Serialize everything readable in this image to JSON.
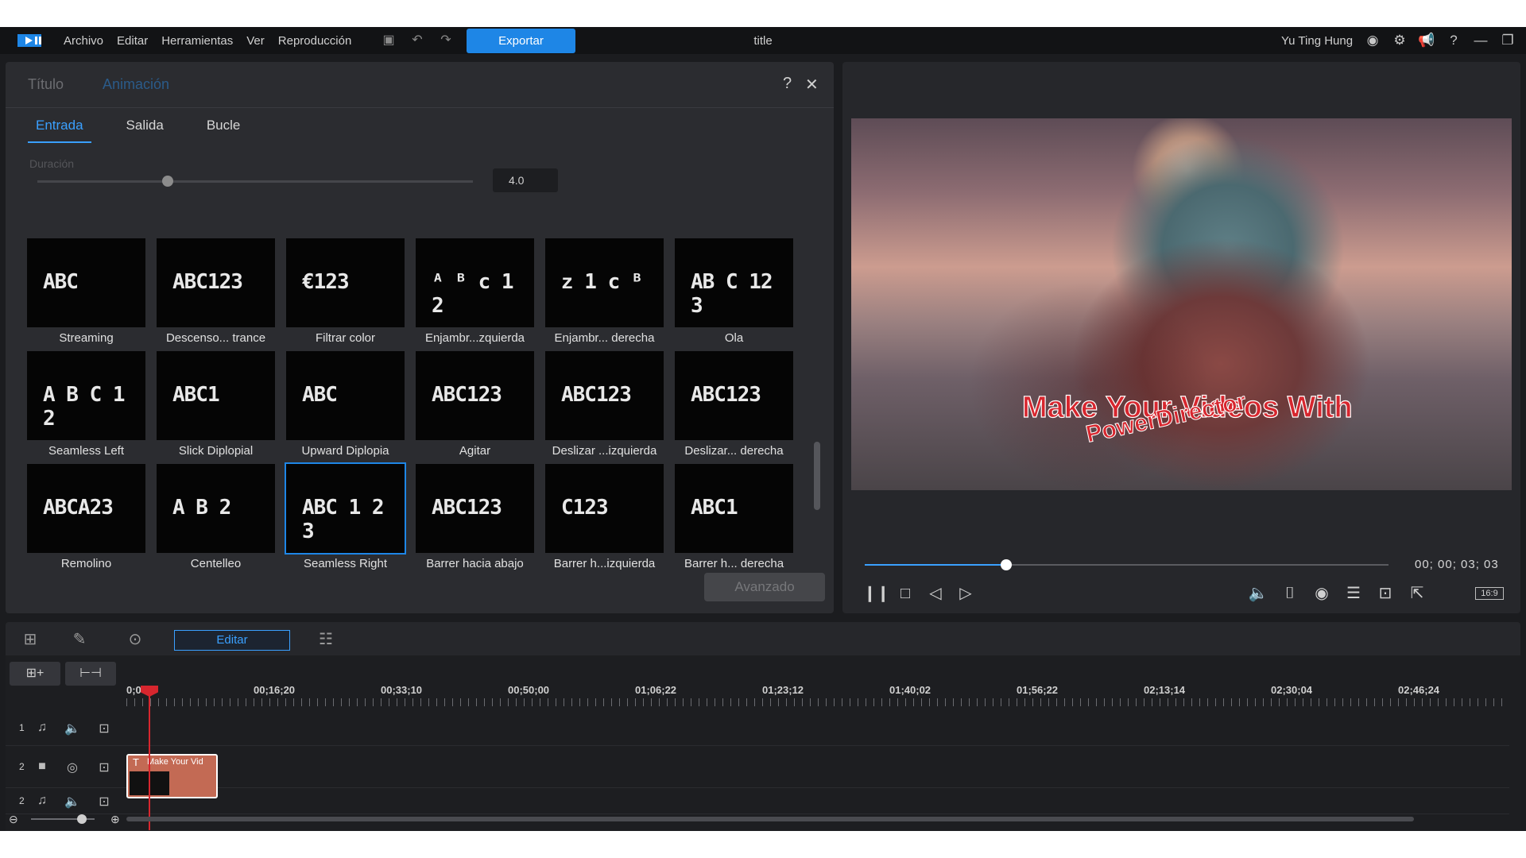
{
  "menubar": {
    "menu_items": [
      "Archivo",
      "Editar",
      "Herramientas",
      "Ver",
      "Reproducción"
    ],
    "export_label": "Exportar",
    "doc_title": "title",
    "user_name": "Yu Ting Hung",
    "accent": "#1e86e6"
  },
  "panel": {
    "tabs": [
      "Título",
      "Animación"
    ],
    "subtabs": [
      "Entrada",
      "Salida",
      "Bucle"
    ],
    "duration_label": "Duración",
    "duration_value": "4.0",
    "duration_level": 0.3,
    "advanced_label": "Avanzado",
    "effects": [
      {
        "label": "Streaming",
        "preview": "ABC"
      },
      {
        "label": "Descenso... trance",
        "preview": "ABC123"
      },
      {
        "label": "Filtrar color",
        "preview": "€123"
      },
      {
        "label": "Enjambr...zquierda",
        "preview": "ᴬ ᴮ c  1  2"
      },
      {
        "label": "Enjambr... derecha",
        "preview": "ᴢ 1 c ᴮ"
      },
      {
        "label": "Ola",
        "preview": "AB C 12 3"
      },
      {
        "label": "Seamless Left",
        "preview": "A B C 1 2"
      },
      {
        "label": "Slick Diplopial",
        "preview": "ABC1"
      },
      {
        "label": "Upward Diplopia",
        "preview": "ABC"
      },
      {
        "label": "Agitar",
        "preview": "ABC123"
      },
      {
        "label": "Deslizar ...izquierda",
        "preview": "ABC123"
      },
      {
        "label": "Deslizar... derecha",
        "preview": "ABC123"
      },
      {
        "label": "Remolino",
        "preview": "ABCA23"
      },
      {
        "label": "Centelleo",
        "preview": "A B  2"
      },
      {
        "label": "Seamless Right",
        "preview": "ABC 1 2 3"
      },
      {
        "label": "Barrer hacia abajo",
        "preview": "ABC123"
      },
      {
        "label": "Barrer h...izquierda",
        "preview": "C123"
      },
      {
        "label": "Barrer h... derecha",
        "preview": "ABC1"
      }
    ],
    "selected_effect": "Seamless Right"
  },
  "preview": {
    "overlay_line1": "Make Your Videos With",
    "overlay_line2": "PowerDirector",
    "timecode": "00; 00; 03; 03",
    "progress": 0.27,
    "aspect": "16:9"
  },
  "timeline": {
    "edit_label": "Editar",
    "ticks": [
      "0;00",
      "00;16;20",
      "00;33;10",
      "00;50;00",
      "01;06;22",
      "01;23;12",
      "01;40;02",
      "01;56;22",
      "02;13;14",
      "02;30;04",
      "02;46;24"
    ],
    "tracks": [
      {
        "num": "1",
        "type": "audio"
      },
      {
        "num": "2",
        "type": "video"
      },
      {
        "num": "2",
        "type": "audio"
      }
    ],
    "clip_label": "Make Your Vid"
  }
}
